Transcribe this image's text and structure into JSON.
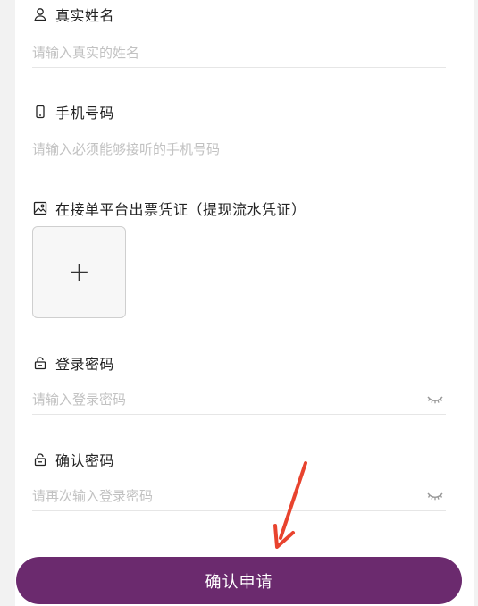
{
  "form": {
    "name": {
      "label": "真实姓名",
      "placeholder": "请输入真实的姓名",
      "icon": "person-icon"
    },
    "phone": {
      "label": "手机号码",
      "placeholder": "请输入必须能够接听的手机号码",
      "icon": "phone-icon"
    },
    "voucher": {
      "label": "在接单平台出票凭证（提现流水凭证）",
      "icon": "image-icon",
      "upload_symbol": "+"
    },
    "password": {
      "label": "登录密码",
      "placeholder": "请输入登录密码",
      "icon": "lock-icon"
    },
    "confirm_password": {
      "label": "确认密码",
      "placeholder": "请再次输入登录密码",
      "icon": "lock-icon"
    }
  },
  "submit_label": "确认申请",
  "colors": {
    "accent": "#6b2a6e",
    "annotation_arrow": "#e8432e"
  }
}
